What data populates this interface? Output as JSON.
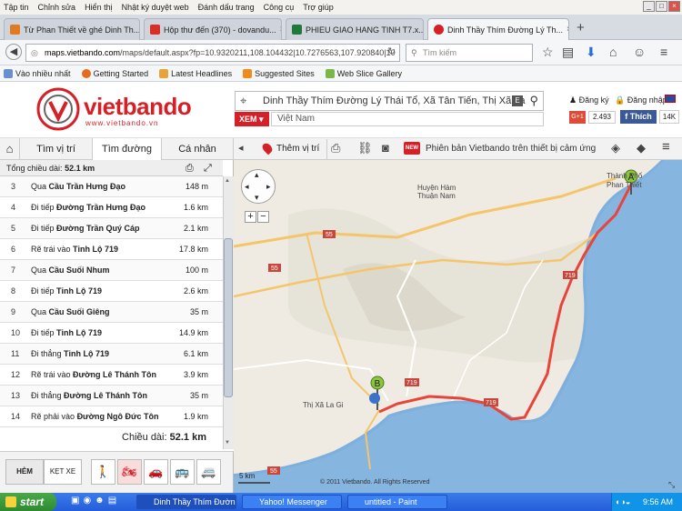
{
  "menu": {
    "items": [
      "Tập tin",
      "Chỉnh sửa",
      "Hiển thị",
      "Nhật ký duyệt web",
      "Đánh dấu trang",
      "Công cụ",
      "Trợ giúp"
    ]
  },
  "tabs": [
    {
      "label": "Từ Phan Thiết về ghé Dinh Th...",
      "color": "#e07b22"
    },
    {
      "label": "Hộp thư đến (370) - dovandu...",
      "color": "#d93025"
    },
    {
      "label": "PHIEU GIAO HANG TINH T7.x...",
      "color": "#1d7a3a"
    },
    {
      "label": "Dinh Thầy Thím Đường Lý Th...",
      "color": "#d62028"
    }
  ],
  "nav": {
    "url_host": "maps.vietbando.com",
    "url_rest": "/maps/default.aspx?fp=10.9320211,108.104432|10.7276563,107.920840|10",
    "search_placeholder": "Tìm kiếm"
  },
  "bookmarks": [
    "Vào nhiều nhất",
    "Getting Started",
    "Latest Headlines",
    "Suggested Sites",
    "Web Slice Gallery"
  ],
  "site": {
    "logo": "vietbando",
    "logo_sub": "www.vietbando.vn",
    "search_value": "Dinh Thầy Thím Đường Lý Thái Tổ, Xã Tân Tiến, Thị Xã La",
    "xem": "XEM",
    "country": "Việt Nam",
    "register": "Đăng ký",
    "login": "Đăng nhập",
    "gplus": "G+1",
    "gplus_count": "2.493",
    "fb_like": "Thích",
    "fb_count": "14K"
  },
  "panel_tabs": [
    "Tìm vị trí",
    "Tìm đường",
    "Cá nhân"
  ],
  "map_tools": {
    "mark": "Thêm vị trí",
    "banner": "Phiên bản Vietbando trên thiết bị cảm ứng",
    "new_badge": "NEW"
  },
  "route": {
    "total_label": "Tổng chiều dài:",
    "total_value": "52.1 km",
    "steps": [
      {
        "n": "3",
        "action": "Qua",
        "road": "Cầu Trần Hưng Đạo",
        "dist": "148 m"
      },
      {
        "n": "4",
        "action": "Đi tiếp",
        "road": "Đường Trần Hưng Đạo",
        "dist": "1.6 km"
      },
      {
        "n": "5",
        "action": "Đi tiếp",
        "road": "Đường Trần Quý Cáp",
        "dist": "2.1 km"
      },
      {
        "n": "6",
        "action": "Rẽ trái vào",
        "road": "Tỉnh Lộ 719",
        "dist": "17.8 km"
      },
      {
        "n": "7",
        "action": "Qua",
        "road": "Cầu Suối Nhum",
        "dist": "100 m"
      },
      {
        "n": "8",
        "action": "Đi tiếp",
        "road": "Tỉnh Lộ 719",
        "dist": "2.6 km"
      },
      {
        "n": "9",
        "action": "Qua",
        "road": "Cầu Suối Giêng",
        "dist": "35 m"
      },
      {
        "n": "10",
        "action": "Đi tiếp",
        "road": "Tỉnh Lộ 719",
        "dist": "14.9 km"
      },
      {
        "n": "11",
        "action": "Đi thẳng",
        "road": "Tỉnh Lộ 719",
        "dist": "6.1 km"
      },
      {
        "n": "12",
        "action": "Rẽ trái vào",
        "road": "Đường Lê Thánh Tôn",
        "dist": "3.9 km"
      },
      {
        "n": "13",
        "action": "Đi thẳng",
        "road": "Đường Lê Thánh Tôn",
        "dist": "35 m"
      },
      {
        "n": "14",
        "action": "Rẽ phải vào",
        "road": "Đường Ngô Đức Tôn",
        "dist": "1.9 km"
      }
    ],
    "length_label": "Chiều dài:",
    "length_value": "52.1 km"
  },
  "modes": {
    "hem": "HẺM",
    "ketxe": "KẸT XE"
  },
  "map": {
    "places": [
      "Thành Phố",
      "Phan Thiết",
      "Huyện Hàm",
      "Thuận Nam",
      "Thị Xã La Gi"
    ],
    "road_labels": [
      "55",
      "55",
      "719",
      "719",
      "719",
      "55"
    ],
    "marker_a": "A",
    "marker_b": "B",
    "scale": "5 km",
    "copyright": "© 2011 Vietbando. All Rights Reserved"
  },
  "taskbar": {
    "start": "start",
    "tasks": [
      "Dinh Thầy Thím Đườn...",
      "Yahoo! Messenger",
      "untitled - Paint"
    ],
    "clock": "9:56 AM"
  }
}
